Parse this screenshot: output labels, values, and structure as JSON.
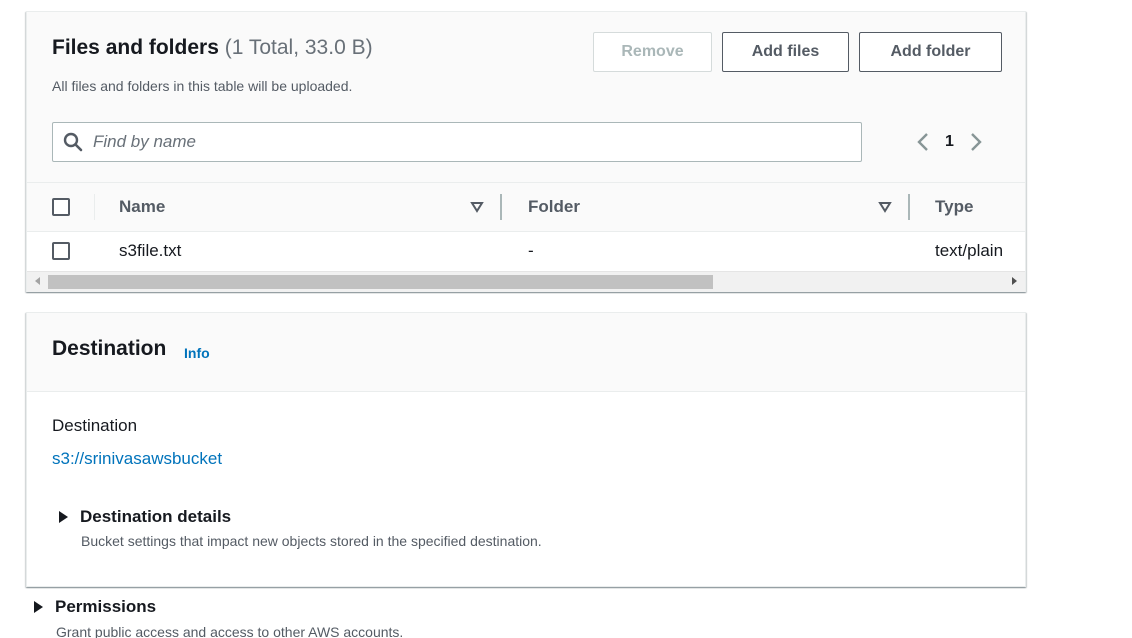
{
  "files_panel": {
    "title": "Files and folders",
    "count": "(1 Total, 33.0 B)",
    "description": "All files and folders in this table will be uploaded.",
    "buttons": {
      "remove": "Remove",
      "add_files": "Add files",
      "add_folder": "Add folder"
    },
    "search": {
      "placeholder": "Find by name",
      "value": ""
    },
    "pagination": {
      "current_page": "1"
    },
    "columns": [
      "Name",
      "Folder",
      "Type"
    ],
    "rows": [
      {
        "name": "s3file.txt",
        "folder": "-",
        "type": "text/plain"
      }
    ]
  },
  "destination_panel": {
    "title": "Destination",
    "info_label": "Info",
    "label": "Destination",
    "link": "s3://srinivasawsbucket",
    "details": {
      "title": "Destination details",
      "description": "Bucket settings that impact new objects stored in the specified destination."
    }
  },
  "permissions": {
    "title": "Permissions",
    "description": "Grant public access and access to other AWS accounts."
  },
  "colors": {
    "link": "#0073bb",
    "text": "#16191f",
    "muted": "#545b64",
    "disabled": "#aab7b8"
  }
}
